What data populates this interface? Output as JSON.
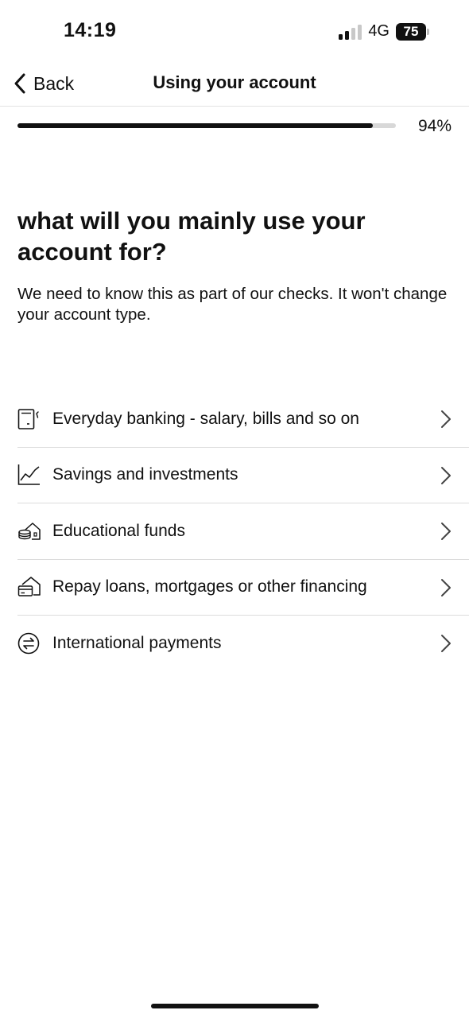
{
  "status_bar": {
    "time": "14:19",
    "network": "4G",
    "battery": "75",
    "signal_bars_active": 2,
    "signal_bars_total": 4
  },
  "nav": {
    "back_label": "Back",
    "title": "Using your account",
    "icons": {
      "back": "chevron-left-icon"
    }
  },
  "progress": {
    "value": 94,
    "label": "94%"
  },
  "page": {
    "heading": "what will you mainly use your account for?",
    "subtext": "We need to know this as part of our checks. It won't change your account type."
  },
  "options": [
    {
      "label": "Everyday banking - salary, bills and so on",
      "icon": "receipt-phone-icon"
    },
    {
      "label": "Savings and investments",
      "icon": "line-chart-icon"
    },
    {
      "label": "Educational funds",
      "icon": "coins-house-icon"
    },
    {
      "label": "Repay loans, mortgages or other financing",
      "icon": "card-house-icon"
    },
    {
      "label": "International payments",
      "icon": "exchange-arrows-icon"
    }
  ],
  "colors": {
    "text": "#111111",
    "divider": "#dcdcdc",
    "progress_track": "#d8d8d8",
    "progress_fill": "#111111"
  }
}
